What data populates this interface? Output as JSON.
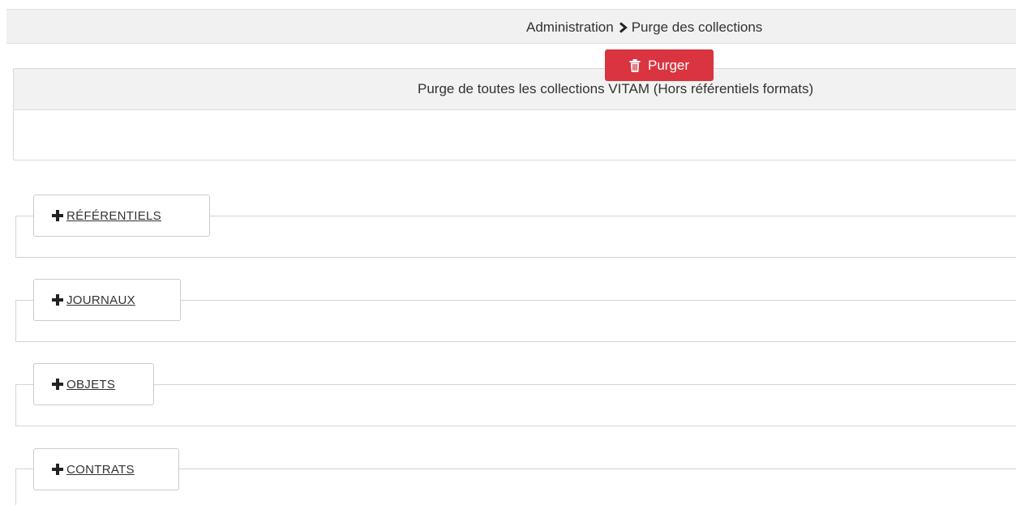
{
  "breadcrumb": {
    "parent": "Administration",
    "current": "Purge des collections",
    "separator_icon": "chevron-right-icon"
  },
  "purge_panel": {
    "title": "Purge de toutes les collections VITAM (Hors référentiels formats)",
    "button_label": "Purger",
    "button_icon": "trash-icon",
    "button_color": "#d9343f"
  },
  "sections": [
    {
      "label": "RÉFÉRENTIELS",
      "icon": "plus-icon"
    },
    {
      "label": "JOURNAUX",
      "icon": "plus-icon"
    },
    {
      "label": "OBJETS",
      "icon": "plus-icon"
    },
    {
      "label": "CONTRATS",
      "icon": "plus-icon"
    }
  ]
}
